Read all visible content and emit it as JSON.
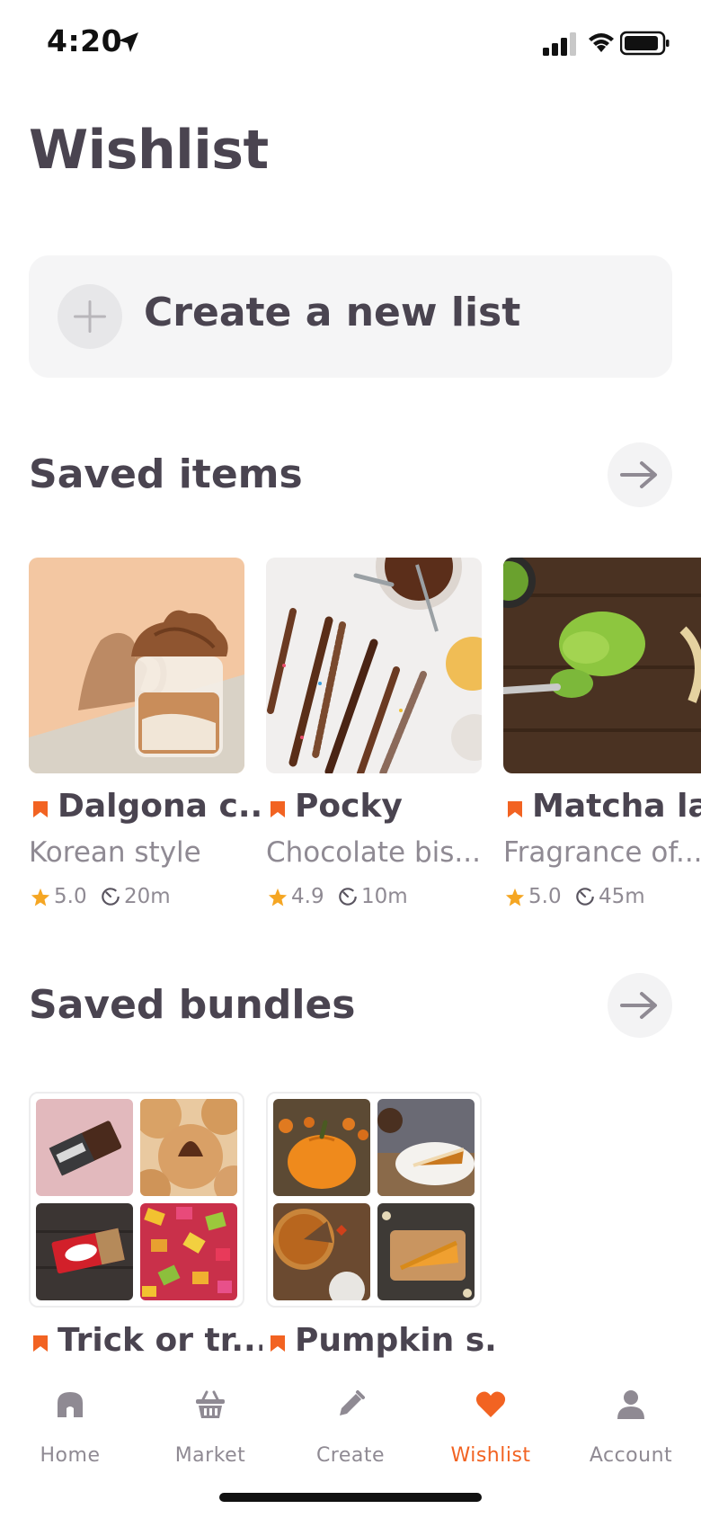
{
  "status_bar": {
    "time": "4:20"
  },
  "page": {
    "title": "Wishlist"
  },
  "create_list": {
    "label": "Create a new list"
  },
  "saved_items": {
    "title": "Saved items",
    "items": [
      {
        "title": "Dalgona c...",
        "subtitle": "Korean style",
        "rating": "5.0",
        "time": "20m",
        "image": "dalgona-coffee-photo"
      },
      {
        "title": "Pocky",
        "subtitle": "Chocolate bis...",
        "rating": "4.9",
        "time": "10m",
        "image": "pocky-sticks-photo"
      },
      {
        "title": "Matcha la...",
        "subtitle": "Fragrance of...",
        "rating": "5.0",
        "time": "45m",
        "image": "matcha-powder-photo"
      }
    ]
  },
  "saved_bundles": {
    "title": "Saved bundles",
    "items": [
      {
        "title": "Trick or tr...",
        "images": [
          "hersheys-bar",
          "kiss-cookies",
          "kitkat-bar",
          "hard-candies"
        ]
      },
      {
        "title": "Pumpkin s...",
        "images": [
          "pumpkin-patch",
          "pie-slice-plate",
          "pumpkin-pie-table",
          "pie-slice-board"
        ]
      }
    ]
  },
  "tabs": [
    {
      "label": "Home",
      "icon": "home-icon",
      "active": false
    },
    {
      "label": "Market",
      "icon": "basket-icon",
      "active": false
    },
    {
      "label": "Create",
      "icon": "pencil-icon",
      "active": false
    },
    {
      "label": "Wishlist",
      "icon": "heart-icon",
      "active": true
    },
    {
      "label": "Account",
      "icon": "user-icon",
      "active": false
    }
  ],
  "colors": {
    "accent": "#f26322",
    "text": "#4a4450",
    "muted": "#8f8a93",
    "star": "#f5a623",
    "card_bg": "#f5f5f6"
  }
}
